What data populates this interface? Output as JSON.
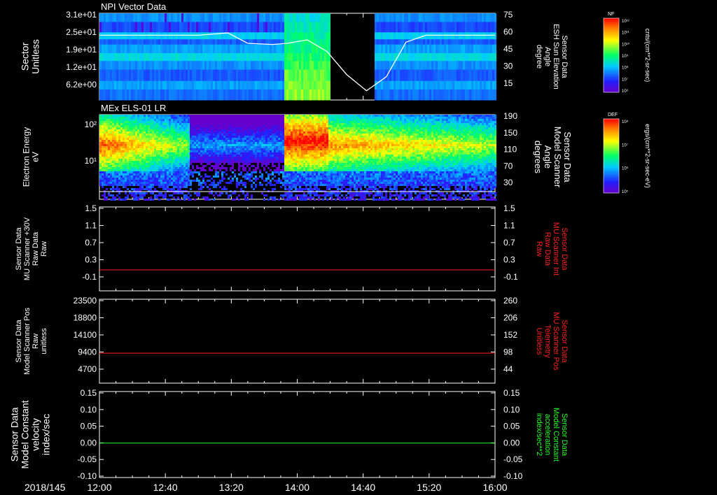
{
  "date_label": "2018/145",
  "x_ticks": [
    "12:00",
    "12:40",
    "13:20",
    "14:00",
    "14:40",
    "15:20",
    "16:00"
  ],
  "colorbars": [
    {
      "code": "NF",
      "top_label": "10¹²",
      "bottom_label": "10⁶",
      "tick_labels": [
        "10¹¹",
        "10¹⁰",
        "10⁹",
        "10⁸",
        "10⁷"
      ],
      "units": "cnts/(cm**2-sr-sec)"
    },
    {
      "code": "DEF",
      "top_label": "10⁸",
      "bottom_label": "10⁵",
      "tick_labels": [
        "10⁷",
        "10⁶"
      ],
      "units": "ergs/(cm**2-sr-sec-eV)"
    }
  ],
  "chart_data": [
    {
      "type": "heatmap",
      "title": "NPI Vector Data",
      "left_axis": {
        "label": [
          "Sector",
          "Unitless"
        ],
        "ticks": [
          "3.1e+01",
          "2.5e+01",
          "1.9e+01",
          "1.2e+01",
          "6.2e+00"
        ],
        "range": [
          0,
          31
        ]
      },
      "right_axis": {
        "label": [
          "Sensor Data",
          "ESH Sun Elevation",
          "Angle",
          "degree"
        ],
        "ticks": [
          "75",
          "60",
          "45",
          "30",
          "15"
        ],
        "range": [
          0,
          75
        ]
      },
      "overlay_series": {
        "name": "ESH Sun Elevation Angle",
        "color": "#ffffff",
        "x_hours": [
          12.0,
          13.0,
          13.3,
          13.5,
          13.75,
          13.9,
          14.1,
          14.3,
          14.5,
          14.7,
          14.9,
          15.1,
          15.3,
          15.6,
          16.0
        ],
        "y": [
          56,
          56,
          58,
          49,
          48,
          49,
          52,
          42,
          22,
          8,
          20,
          50,
          56,
          56,
          56
        ]
      },
      "data_gap_hours": [
        14.33,
        14.78
      ]
    },
    {
      "type": "heatmap",
      "title": "MEx ELS-01 LR",
      "left_axis": {
        "label": [
          "Electron Energy",
          "eV"
        ],
        "ticks": [
          "10²",
          "10¹"
        ],
        "scale": "log"
      },
      "right_axis": {
        "label": [
          "Sensor Data",
          "Model Scanner",
          "Angle",
          "degrees"
        ],
        "ticks": [
          "190",
          "150",
          "110",
          "70",
          "30"
        ],
        "range": [
          0,
          190
        ]
      }
    },
    {
      "type": "line",
      "left_axis": {
        "label": [
          "Sensor Data",
          "MU Scanner +30V",
          "Raw Data",
          "Raw"
        ],
        "ticks": [
          "1.5",
          "1.1",
          "0.7",
          "0.3",
          "-0.1"
        ],
        "range": [
          -0.5,
          1.5
        ]
      },
      "right_axis": {
        "label": [
          "Sensor Data",
          "MU Scanner Int",
          "Raw Data",
          "Raw"
        ],
        "ticks": [
          "1.5",
          "1.1",
          "0.7",
          "0.3",
          "-0.1"
        ],
        "range": [
          -0.5,
          1.5
        ],
        "color": "#ff2020"
      },
      "series": [
        {
          "color": "#ff2020",
          "x_hours": [
            12.0,
            16.0
          ],
          "y": [
            0.0,
            0.0
          ]
        }
      ]
    },
    {
      "type": "line",
      "left_axis": {
        "label": [
          "Sensor Data",
          "Model Scanner Pos",
          "Raw",
          "unitless"
        ],
        "ticks": [
          "23500",
          "18800",
          "14100",
          "9400",
          "4700"
        ],
        "range": [
          0,
          23500
        ]
      },
      "right_axis": {
        "label": [
          "Sensor Data",
          "MU Scanner Pos",
          "Telemetry",
          "Unitless"
        ],
        "ticks": [
          "260",
          "206",
          "152",
          "98",
          "44"
        ],
        "range": [
          0,
          260
        ],
        "color": "#ff2020"
      },
      "series": [
        {
          "color": "#ff2020",
          "x_hours": [
            12.0,
            16.0
          ],
          "y": [
            8400,
            8400
          ]
        }
      ]
    },
    {
      "type": "line",
      "left_axis": {
        "label": [
          "Sensor Data",
          "Model Constant",
          "velocity",
          "index/sec"
        ],
        "ticks": [
          "0.15",
          "0.10",
          "0.05",
          "0.00",
          "-0.05",
          "-0.10"
        ],
        "range": [
          -0.1,
          0.15
        ]
      },
      "right_axis": {
        "label": [
          "Sensor Data",
          "Model Constant",
          "acceleration",
          "index/sec**2"
        ],
        "ticks": [
          "0.15",
          "0.10",
          "0.05",
          "0.00",
          "-0.05",
          "-0.10"
        ],
        "range": [
          -0.1,
          0.15
        ],
        "color": "#20ff20"
      },
      "series": [
        {
          "color": "#20ff20",
          "x_hours": [
            12.0,
            16.0
          ],
          "y": [
            0.0,
            0.0
          ]
        }
      ]
    }
  ]
}
